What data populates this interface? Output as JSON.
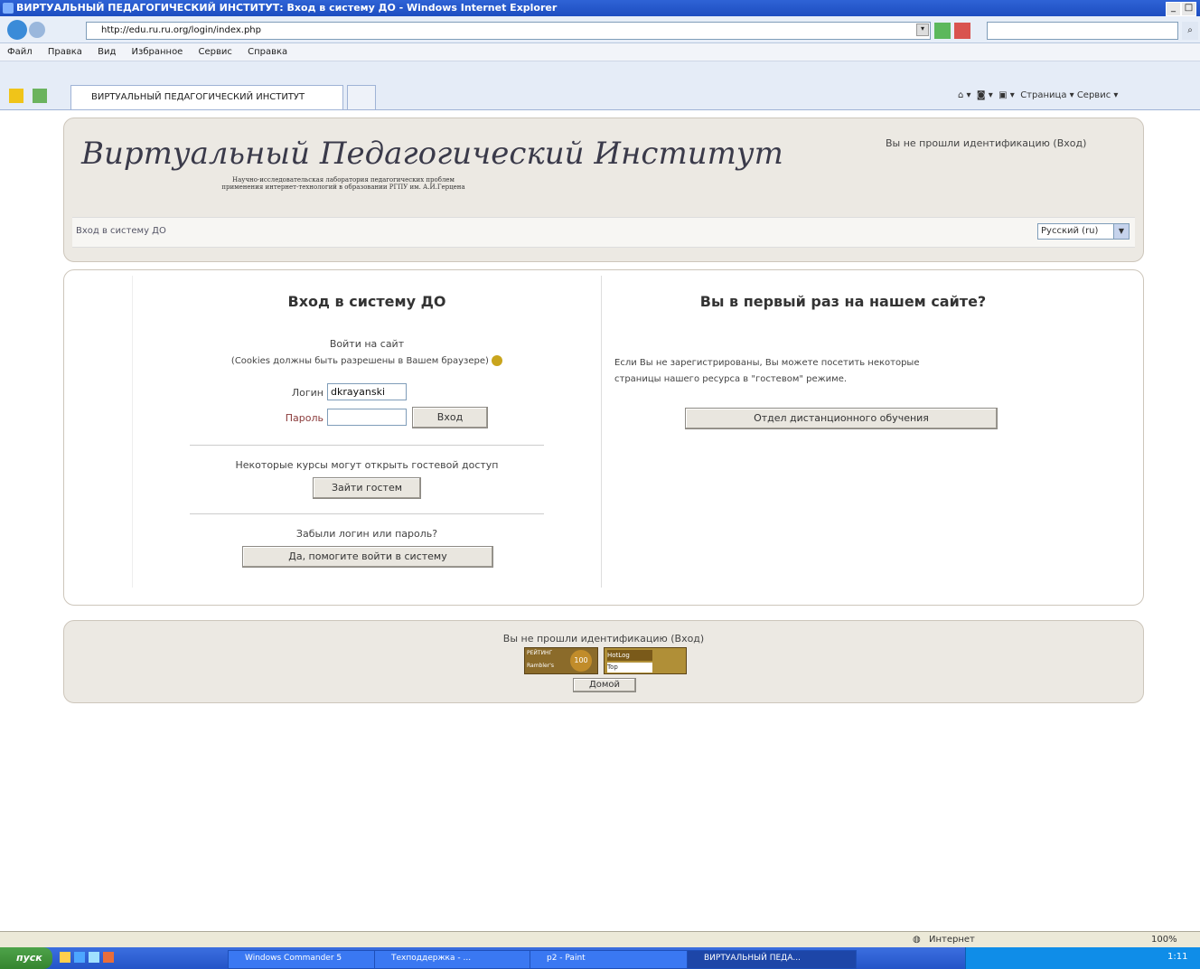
{
  "window": {
    "title": "ВИРТУАЛЬНЫЙ ПЕДАГОГИЧЕСКИЙ ИНСТИТУТ: Вход в систему ДО - Windows Internet Explorer"
  },
  "browser": {
    "url": "http://edu.ru.ru.org/login/index.php",
    "search_placeholder": "",
    "menu": [
      "Файл",
      "Правка",
      "Вид",
      "Избранное",
      "Сервис",
      "Справка"
    ],
    "tab_title": "ВИРТУАЛЬНЫЙ ПЕДАГОГИЧЕСКИЙ ИНСТИТУТ",
    "command_bar": "Страница ▾ Сервис ▾"
  },
  "header": {
    "logo": "Виртуальный Педагогический Институт",
    "subtitle_line1": "Научно-исследовательская лаборатория педагогических проблем",
    "subtitle_line2": "применения интернет-технологий в образовании РГПУ им. А.И.Герцена",
    "login_info": "Вы не прошли идентификацию (Вход)",
    "breadcrumb": "Вход в систему ДО",
    "language": "Русский (ru)"
  },
  "login": {
    "heading": "Вход в систему ДО",
    "intro": "Войти на сайт",
    "cookie_note": "(Cookies должны быть разрешены в Вашем браузере)",
    "login_label": "Логин",
    "login_value": "dkrayanski",
    "password_label": "Пароль",
    "submit": "Вход",
    "guest_note": "Некоторые курсы могут открыть гостевой доступ",
    "guest_button": "Зайти гостем",
    "forgot_note": "Забыли логин или пароль?",
    "forgot_button": "Да, помогите войти в систему"
  },
  "signup": {
    "heading": "Вы в первый раз на нашем сайте?",
    "text_line1": "Если Вы не зарегистрированы, Вы можете посетить некоторые",
    "text_line2": "страницы нашего ресурса в \"гостевом\" режиме.",
    "button": "Отдел дистанционного обучения"
  },
  "footer": {
    "login_info": "Вы не прошли идентификацию (Вход)",
    "badge1_top": "РЕЙТИНГ",
    "badge1_bottom": "Rambler's",
    "badge1_mid": "100",
    "badge2_top": "HotLog",
    "badge2_bottom": "Top",
    "home_link": "Домой"
  },
  "statusbar": {
    "zone": "Интернет",
    "zoom": "100%"
  },
  "taskbar": {
    "start": "пуск",
    "tasks": [
      "Windows Commander 5",
      "Техподдержка - ...",
      "p2 - Paint",
      "ВИРТУАЛЬНЫЙ ПЕДА..."
    ],
    "clock": "1:11"
  }
}
